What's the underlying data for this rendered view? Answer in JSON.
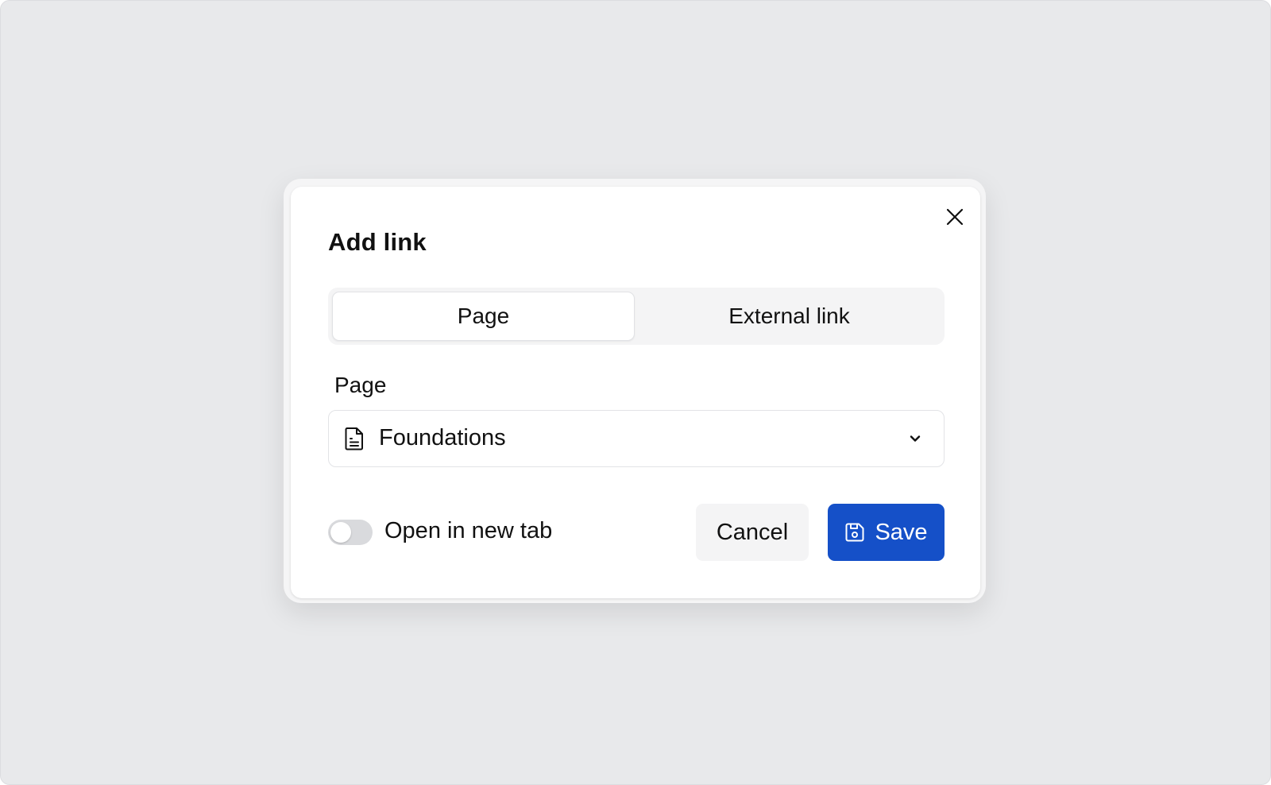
{
  "dialog": {
    "title": "Add link",
    "close_icon": "close-icon"
  },
  "link_type_tabs": [
    {
      "label": "Page",
      "selected": true
    },
    {
      "label": "External link",
      "selected": false
    }
  ],
  "page_field": {
    "label": "Page",
    "value": "Foundations",
    "icon": "document-icon",
    "dropdown_icon": "chevron-down-icon"
  },
  "new_tab_toggle": {
    "label": "Open in new tab",
    "on": false
  },
  "actions": {
    "cancel_label": "Cancel",
    "save_label": "Save",
    "save_icon": "floppy-disk-icon"
  },
  "colors": {
    "backdrop": "#e8e9eb",
    "primary": "#1550c8",
    "secondary_button": "#f4f4f5",
    "toggle_off": "#d9dadd"
  }
}
